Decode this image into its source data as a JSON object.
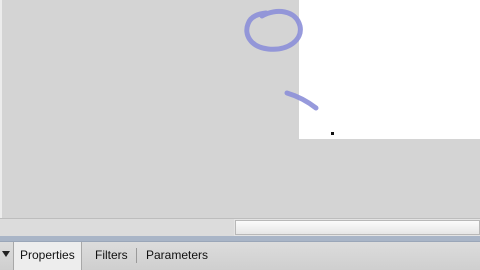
{
  "panel": {
    "tabs": [
      {
        "label": "Properties",
        "active": true
      },
      {
        "label": "Filters",
        "active": false
      },
      {
        "label": "Parameters",
        "active": false
      }
    ],
    "collapse_icon": "triangle-down-icon"
  },
  "stage": {
    "background": "#ffffff"
  },
  "pasteboard": {
    "background": "#d4d4d4"
  },
  "annotation": {
    "stroke_color": "#8c8fd8",
    "shapes": [
      "hand-drawn-circle",
      "hand-drawn-arc"
    ]
  }
}
